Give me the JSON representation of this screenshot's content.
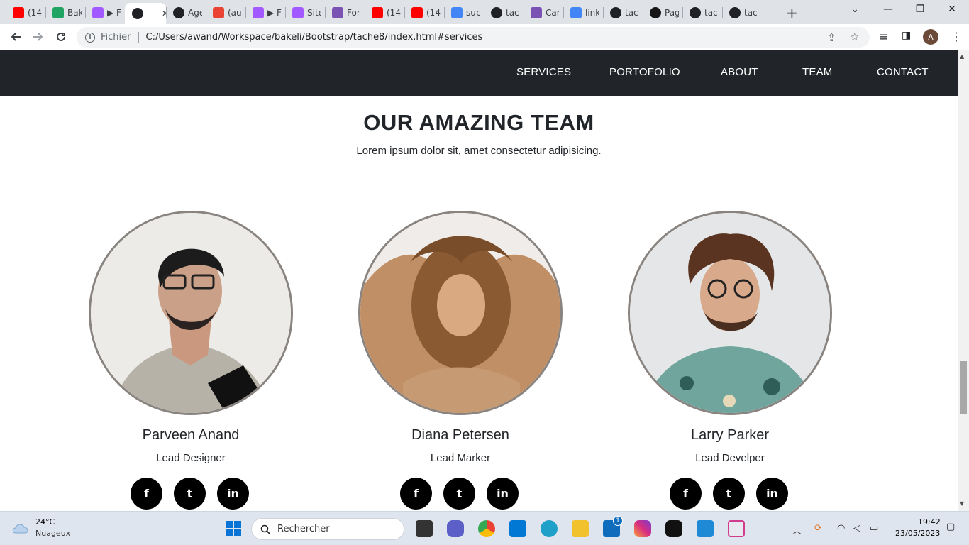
{
  "browser": {
    "tabs": [
      {
        "label": "(14",
        "icon": "youtube-icon",
        "color": "#ff0000"
      },
      {
        "label": "Bak",
        "icon": "drive-icon",
        "color": "#1fa463"
      },
      {
        "label": "▶ F",
        "icon": "figma-icon",
        "color": "#a259ff"
      },
      {
        "label": "",
        "icon": "globe-icon",
        "color": "#202124",
        "active": true
      },
      {
        "label": "Age",
        "icon": "globe-icon",
        "color": "#202124"
      },
      {
        "label": "(au",
        "icon": "gmail-icon",
        "color": "#ea4335"
      },
      {
        "label": "▶ F",
        "icon": "figma-icon",
        "color": "#a259ff"
      },
      {
        "label": "Site",
        "icon": "figma-icon",
        "color": "#a259ff"
      },
      {
        "label": "For",
        "icon": "bootstrap-icon",
        "color": "#7952b3"
      },
      {
        "label": "(14",
        "icon": "youtube-icon",
        "color": "#ff0000"
      },
      {
        "label": "(14",
        "icon": "youtube-icon",
        "color": "#ff0000"
      },
      {
        "label": "sup",
        "icon": "google-icon",
        "color": "#4285f4"
      },
      {
        "label": "tac",
        "icon": "globe-icon",
        "color": "#202124"
      },
      {
        "label": "Car",
        "icon": "bootstrap-icon",
        "color": "#7952b3"
      },
      {
        "label": "link",
        "icon": "google-icon",
        "color": "#4285f4"
      },
      {
        "label": "tac",
        "icon": "globe-icon",
        "color": "#202124"
      },
      {
        "label": "Pag",
        "icon": "github-icon",
        "color": "#181717"
      },
      {
        "label": "tac",
        "icon": "globe-icon",
        "color": "#202124"
      },
      {
        "label": "tac",
        "icon": "globe-icon",
        "color": "#202124"
      }
    ],
    "active_close": "✕",
    "new_tab": "+",
    "omnibox": {
      "scheme_label": "Fichier",
      "url": "C:/Users/awand/Workspace/bakeli/Bootstrap/tache8/index.html#services"
    },
    "profile_initial": "A"
  },
  "site": {
    "nav": [
      "SERVICES",
      "PORTOFOLIO",
      "ABOUT",
      "TEAM",
      "CONTACT"
    ],
    "section_title": "OUR AMAZING TEAM",
    "section_subtitle": "Lorem ipsum dolor sit, amet consectetur adipisicing.",
    "members": [
      {
        "name": "Parveen Anand",
        "role": "Lead Designer"
      },
      {
        "name": "Diana Petersen",
        "role": "Lead Marker"
      },
      {
        "name": "Larry Parker",
        "role": "Lead Develper"
      }
    ],
    "social_labels": [
      "f",
      "t",
      "in"
    ]
  },
  "taskbar": {
    "weather_temp": "24°C",
    "weather_desc": "Nuageux",
    "search_placeholder": "Rechercher",
    "time": "19:42",
    "date": "23/05/2023",
    "mail_badge": "1"
  },
  "colors": {
    "navbar": "#212529",
    "tabstrip": "#dfe3e8",
    "taskbar": "#dfe5ef"
  }
}
